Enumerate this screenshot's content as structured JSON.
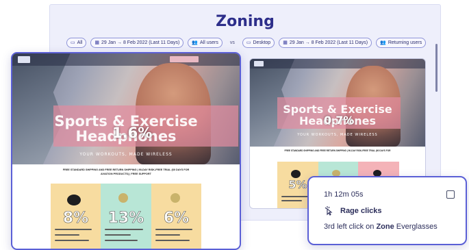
{
  "page": {
    "title": "Zoning"
  },
  "filters": {
    "left": [
      {
        "icon": "device-icon",
        "label": "All"
      },
      {
        "icon": "calendar-icon",
        "label": "29 Jan → 8 Feb 2022 (Last 11 Days)"
      },
      {
        "icon": "users-icon",
        "label": "All users"
      }
    ],
    "vs_label": "vs",
    "right": [
      {
        "icon": "desktop-icon",
        "label": "Desktop"
      },
      {
        "icon": "calendar-icon",
        "label": "29 Jan → 8 Feb 2022 (Last 11 Days)"
      },
      {
        "icon": "users-icon",
        "label": "Returning users"
      }
    ]
  },
  "left_shot": {
    "headline_line1": "Sports & Exercise",
    "headline_line2": "Headphones",
    "tagline": "YOUR WORKOUTS, MADE WIRELESS",
    "hero_zone_pct": "1.6%",
    "shipping_line1": "FREE STANDARD SHIPPING AND FREE RETURN SHIPPING | 90-DAY RISK-FREE TRIAL (60 DAYS FOR",
    "shipping_line2": "AVIATION PRODUCTS) | FREE SUPPORT",
    "products": [
      {
        "zone_pct": "8%",
        "bg": "#f7dca0"
      },
      {
        "zone_pct": "13%",
        "bg": "#b8e6d6"
      },
      {
        "zone_pct": "6%",
        "bg": "#f7dca0"
      }
    ]
  },
  "right_shot": {
    "headline_line1": "Sports & Exercise",
    "headline_line2": "Headphones",
    "tagline": "YOUR WORKOUTS, MADE WIRELESS",
    "hero_zone_pct": "0.7%",
    "shipping_line1": "FREE STANDARD SHIPPING AND FREE RETURN SHIPPING | 90-DAY RISK-FREE TRIAL (60 DAYS FOR",
    "shipping_line2": "AVIATION PRODUCTS) | FREE SUPPORT",
    "products": [
      {
        "zone_pct": "5%",
        "bg": "#f7dca0"
      },
      {
        "zone_pct": "",
        "bg": "#b8e6d6"
      },
      {
        "zone_pct": "",
        "bg": "#f4b3b8"
      }
    ]
  },
  "tooltip": {
    "time": "1h 12m 05s",
    "event_icon": "rage-click-icon",
    "event": "Rage clicks",
    "desc_prefix": "3rd left click on",
    "desc_zone_word": "Zone",
    "desc_zone_name": "Everglasses"
  },
  "colors": {
    "accent": "#5a5fd6",
    "title": "#2d2e8a",
    "panel": "#eeeffb"
  }
}
